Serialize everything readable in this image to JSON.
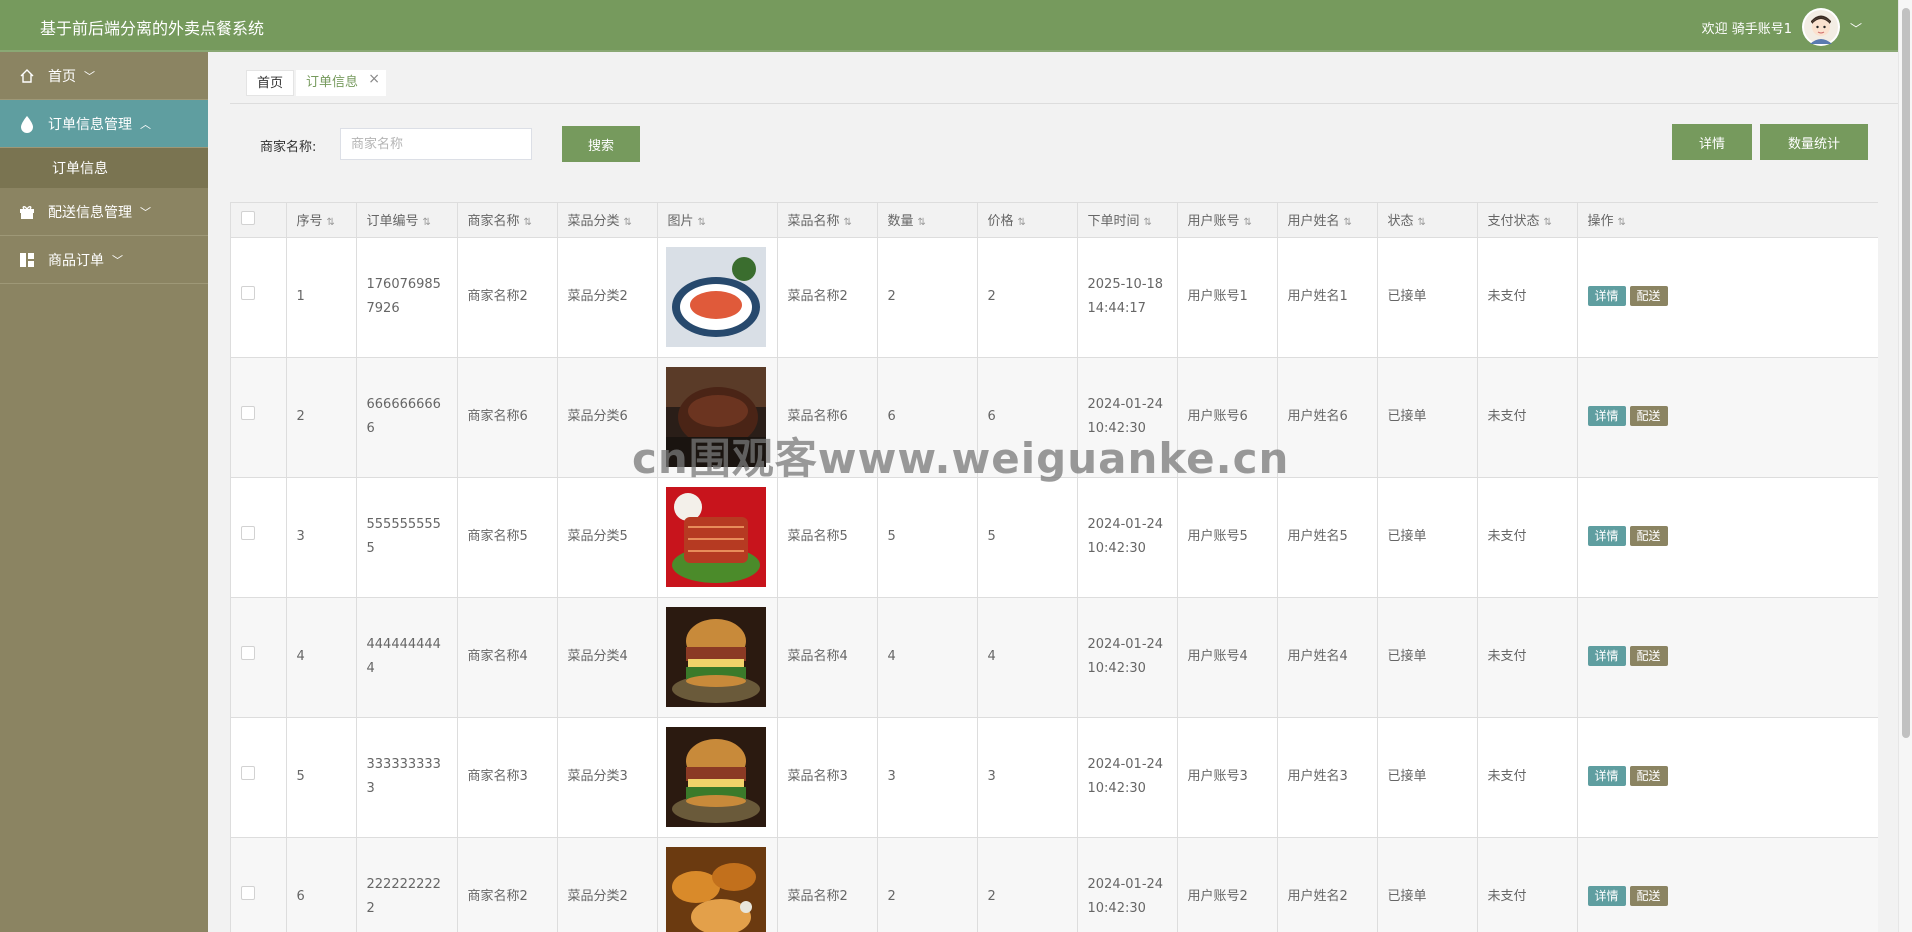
{
  "app": {
    "title": "基于前后端分离的外卖点餐系统"
  },
  "header": {
    "welcome": "欢迎 骑手账号1",
    "avatar_icon": "user-avatar",
    "dropdown_icon": "chevron-down-icon"
  },
  "sidebar": {
    "items": [
      {
        "label": "首页",
        "icon": "home-icon"
      },
      {
        "label": "订单信息管理",
        "icon": "drop-icon",
        "expanded": true,
        "children": [
          {
            "label": "订单信息"
          }
        ]
      },
      {
        "label": "配送信息管理",
        "icon": "gift-icon"
      },
      {
        "label": "商品订单",
        "icon": "grid-icon"
      }
    ]
  },
  "tabs": [
    {
      "label": "首页"
    },
    {
      "label": "订单信息"
    }
  ],
  "search": {
    "label": "商家名称:",
    "placeholder": "商家名称",
    "value": "",
    "button": "搜索"
  },
  "actions": {
    "detail": "详情",
    "stats": "数量统计"
  },
  "table": {
    "columns": [
      "序号",
      "订单编号",
      "商家名称",
      "菜品分类",
      "图片",
      "菜品名称",
      "数量",
      "价格",
      "下单时间",
      "用户账号",
      "用户姓名",
      "状态",
      "支付状态",
      "操作"
    ],
    "row_buttons": {
      "detail": "详情",
      "ship": "配送"
    },
    "rows": [
      {
        "idx": "1",
        "order_no": "1760769857926",
        "merchant": "商家名称2",
        "category": "菜品分类2",
        "dish": "菜品名称2",
        "qty": "2",
        "price": "2",
        "time": "2025-10-18 14:44:17",
        "account": "用户账号1",
        "name": "用户姓名1",
        "status": "已接单",
        "pay": "未支付",
        "img": "fish-dish"
      },
      {
        "idx": "2",
        "order_no": "6666666666",
        "merchant": "商家名称6",
        "category": "菜品分类6",
        "dish": "菜品名称6",
        "qty": "6",
        "price": "6",
        "time": "2024-01-24 10:42:30",
        "account": "用户账号6",
        "name": "用户姓名6",
        "status": "已接单",
        "pay": "未支付",
        "img": "braised-meat"
      },
      {
        "idx": "3",
        "order_no": "5555555555",
        "merchant": "商家名称5",
        "category": "菜品分类5",
        "dish": "菜品名称5",
        "qty": "5",
        "price": "5",
        "time": "2024-01-24 10:42:30",
        "account": "用户账号5",
        "name": "用户姓名5",
        "status": "已接单",
        "pay": "未支付",
        "img": "pork-belly"
      },
      {
        "idx": "4",
        "order_no": "4444444444",
        "merchant": "商家名称4",
        "category": "菜品分类4",
        "dish": "菜品名称4",
        "qty": "4",
        "price": "4",
        "time": "2024-01-24 10:42:30",
        "account": "用户账号4",
        "name": "用户姓名4",
        "status": "已接单",
        "pay": "未支付",
        "img": "burger"
      },
      {
        "idx": "5",
        "order_no": "3333333333",
        "merchant": "商家名称3",
        "category": "菜品分类3",
        "dish": "菜品名称3",
        "qty": "3",
        "price": "3",
        "time": "2024-01-24 10:42:30",
        "account": "用户账号3",
        "name": "用户姓名3",
        "status": "已接单",
        "pay": "未支付",
        "img": "burger"
      },
      {
        "idx": "6",
        "order_no": "2222222222",
        "merchant": "商家名称2",
        "category": "菜品分类2",
        "dish": "菜品名称2",
        "qty": "2",
        "price": "2",
        "time": "2024-01-24 10:42:30",
        "account": "用户账号2",
        "name": "用户姓名2",
        "status": "已接单",
        "pay": "未支付",
        "img": "fried-chicken"
      }
    ]
  },
  "watermark": "cn围观客www.weiguanke.cn",
  "colors": {
    "header": "#769a5d",
    "sidebar": "#8b8462",
    "sidebar_active": "#5f9ea0",
    "primary_button": "#769a5d"
  }
}
